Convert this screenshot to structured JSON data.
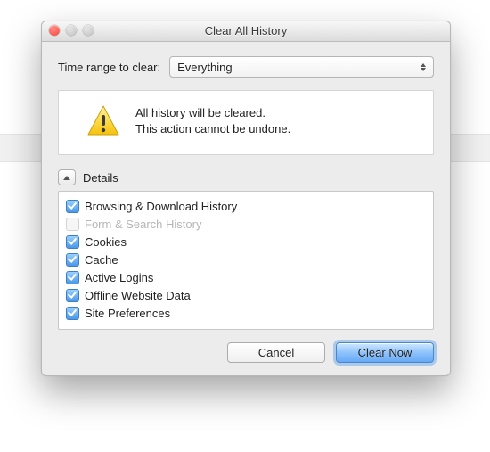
{
  "window": {
    "title": "Clear All History"
  },
  "range": {
    "label": "Time range to clear:",
    "value": "Everything"
  },
  "warning": {
    "line1": "All history will be cleared.",
    "line2": "This action cannot be undone."
  },
  "details": {
    "label": "Details"
  },
  "items": [
    {
      "label": "Browsing & Download History",
      "checked": true,
      "enabled": true
    },
    {
      "label": "Form & Search History",
      "checked": false,
      "enabled": false
    },
    {
      "label": "Cookies",
      "checked": true,
      "enabled": true
    },
    {
      "label": "Cache",
      "checked": true,
      "enabled": true
    },
    {
      "label": "Active Logins",
      "checked": true,
      "enabled": true
    },
    {
      "label": "Offline Website Data",
      "checked": true,
      "enabled": true
    },
    {
      "label": "Site Preferences",
      "checked": true,
      "enabled": true
    }
  ],
  "buttons": {
    "cancel": "Cancel",
    "clear": "Clear Now"
  }
}
